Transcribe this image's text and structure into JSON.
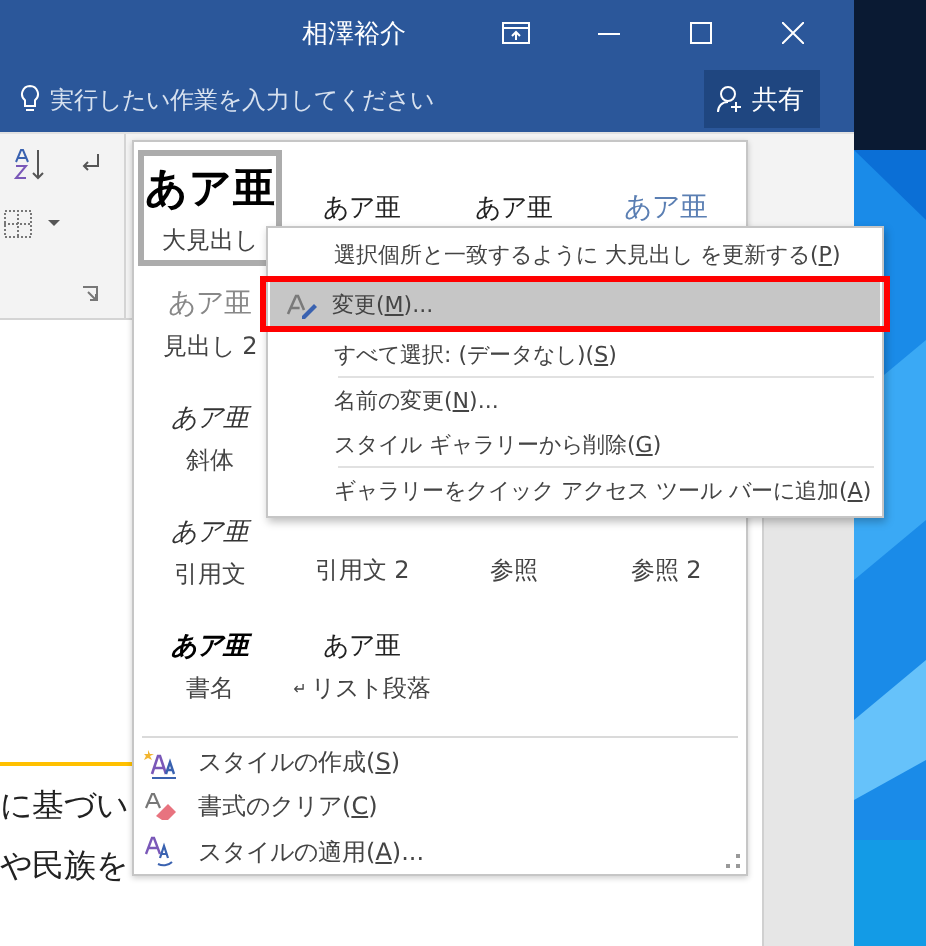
{
  "window": {
    "user": "相澤裕介"
  },
  "tell_me": {
    "placeholder": "実行したい作業を入力してください"
  },
  "share_button": {
    "label": "共有"
  },
  "document": {
    "lines": [
      "に基づい",
      "や民族を"
    ]
  },
  "style_gallery": {
    "rows": [
      [
        {
          "sample": "あア亜",
          "label": "大見出し",
          "kind": "title",
          "selected": true
        },
        {
          "sample": "あア亜",
          "kind": "normal",
          "selected": false
        },
        {
          "sample": "あア亜",
          "kind": "normal",
          "selected": false
        },
        {
          "sample": "あア亜",
          "kind": "heading",
          "selected": false
        }
      ],
      [
        {
          "sample": "あア亜",
          "label": "見出し 2",
          "kind": "subtle",
          "selected": false
        }
      ],
      [
        {
          "sample": "あア亜",
          "label": "斜体",
          "kind": "emphasis",
          "selected": false
        }
      ],
      [
        {
          "sample": "あア亜",
          "label": "引用文",
          "kind": "emphasis",
          "selected": false
        },
        {
          "label": "引用文 2",
          "selected": false
        },
        {
          "label": "参照",
          "selected": false
        },
        {
          "label": "参照 2",
          "selected": false
        }
      ],
      [
        {
          "sample": "あア亜",
          "label": "書名",
          "kind": "strong",
          "selected": false
        },
        {
          "sample": "あア亜",
          "label": "リスト段落",
          "mark": "↵",
          "kind": "normal",
          "selected": false
        }
      ]
    ],
    "commands": [
      {
        "kind": "create",
        "before": "スタイルの作成(",
        "key": "S",
        "after": ")"
      },
      {
        "kind": "clear",
        "before": "書式のクリア(",
        "key": "C",
        "after": ")"
      },
      {
        "kind": "apply",
        "before": "スタイルの適用(",
        "key": "A",
        "after": ")..."
      }
    ]
  },
  "context_menu": {
    "items": [
      {
        "before": "選択個所と一致するように 大見出し を更新する(",
        "key": "P",
        "after": ")",
        "highlighted": false,
        "annotated": false
      },
      {
        "before": "変更(",
        "key": "M",
        "after": ")...",
        "icon": true,
        "highlighted": true,
        "annotated": true
      },
      {
        "before": "すべて選択: (データなし)(",
        "key": "S",
        "after": ")",
        "highlighted": false,
        "annotated": false,
        "separator_after": true
      },
      {
        "before": "名前の変更(",
        "key": "N",
        "after": ")...",
        "highlighted": false,
        "annotated": false
      },
      {
        "before": "スタイル ギャラリーから削除(",
        "key": "G",
        "after": ")",
        "highlighted": false,
        "annotated": false,
        "separator_after": true
      },
      {
        "before": "ギャラリーをクイック アクセス ツール バーに追加(",
        "key": "A",
        "after": ")",
        "highlighted": false,
        "annotated": false
      }
    ]
  }
}
